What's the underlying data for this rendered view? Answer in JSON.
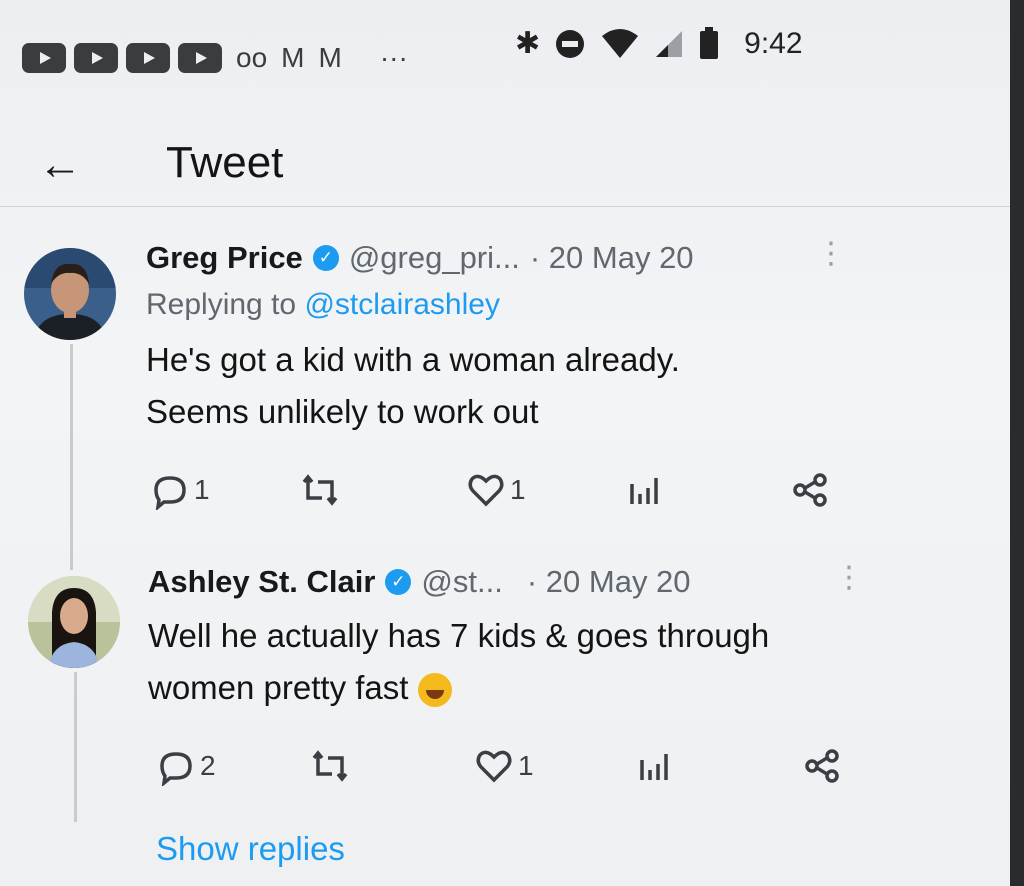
{
  "status_bar": {
    "time": "9:42",
    "left_icons": [
      "youtube-icon",
      "youtube-icon",
      "youtube-icon",
      "youtube-icon",
      "voicemail-icon",
      "gmail-icon",
      "gmail-icon",
      "more-dots-icon"
    ],
    "right_icons": [
      "bluetooth-icon",
      "do-not-disturb-icon",
      "wifi-icon",
      "cell-signal-icon",
      "battery-icon"
    ],
    "voicemail_glyph": "oo",
    "gmail_glyph": "M",
    "more_glyph": "···",
    "bluetooth_glyph": "✱"
  },
  "header": {
    "title": "Tweet",
    "back_glyph": "←"
  },
  "tweets": [
    {
      "name": "Greg Price",
      "verified_glyph": "✓",
      "handle": "@greg_pri...",
      "date": "· 20 May 20",
      "more_glyph": "⋮",
      "replying_prefix": "Replying to ",
      "replying_handle": "@stclairashley",
      "text_line1": "He's got a kid with a woman already.",
      "text_line2": "Seems unlikely to work out",
      "reply_count": "1",
      "retweet_count": "",
      "like_count": "1"
    },
    {
      "name": "Ashley St. Clair",
      "verified_glyph": "✓",
      "handle": "@st...",
      "date": "· 20 May 20",
      "more_glyph": "⋮",
      "text_line1": "Well he actually has 7 kids & goes through",
      "text_line2": "women pretty fast",
      "reply_count": "2",
      "retweet_count": "",
      "like_count": "1"
    }
  ],
  "show_replies": "Show replies",
  "colors": {
    "accent": "#1d9bf0",
    "text": "#141414",
    "muted": "#60676e"
  }
}
